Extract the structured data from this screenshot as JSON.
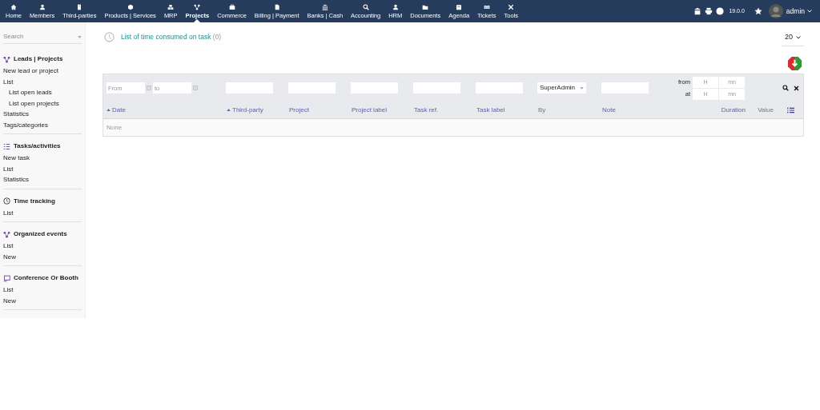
{
  "top_menu": [
    {
      "label": "Home",
      "selected": false
    },
    {
      "label": "Members",
      "selected": false
    },
    {
      "label": "Third-parties",
      "selected": false
    },
    {
      "label": "Products | Services",
      "selected": false
    },
    {
      "label": "MRP",
      "selected": false
    },
    {
      "label": "Projects",
      "selected": true
    },
    {
      "label": "Commerce",
      "selected": false
    },
    {
      "label": "Billing | Payment",
      "selected": false
    },
    {
      "label": "Banks | Cash",
      "selected": false
    },
    {
      "label": "Accounting",
      "selected": false
    },
    {
      "label": "HRM",
      "selected": false
    },
    {
      "label": "Documents",
      "selected": false
    },
    {
      "label": "Agenda",
      "selected": false
    },
    {
      "label": "Tickets",
      "selected": false
    },
    {
      "label": "Tools",
      "selected": false
    }
  ],
  "top_right": {
    "version": "19.0.0",
    "user": "admin"
  },
  "sidebar": {
    "search": {
      "placeholder": "Search"
    },
    "sections": [
      {
        "title": "Leads | Projects",
        "items": [
          {
            "label": "New lead or project"
          },
          {
            "label": "List",
            "children": [
              {
                "label": "List open leads"
              },
              {
                "label": "List open projects"
              }
            ]
          },
          {
            "label": "Statistics"
          },
          {
            "label": "Tags/categories"
          }
        ]
      },
      {
        "title": "Tasks/activities",
        "items": [
          {
            "label": "New task"
          },
          {
            "label": "List"
          },
          {
            "label": "Statistics"
          }
        ]
      },
      {
        "title": "Time tracking",
        "items": [
          {
            "label": "List"
          }
        ]
      },
      {
        "title": "Organized events",
        "items": [
          {
            "label": "List"
          },
          {
            "label": "New"
          }
        ]
      },
      {
        "title": "Conference Or Booth",
        "items": [
          {
            "label": "List"
          },
          {
            "label": "New"
          }
        ]
      }
    ]
  },
  "page": {
    "title": "List of time consumed on task",
    "count": "(0)",
    "page_size": "20"
  },
  "filters": {
    "date_from": {
      "placeholder": "From"
    },
    "date_to": {
      "placeholder": "to"
    },
    "by": "SuperAdmin",
    "duration": [
      {
        "label": "from",
        "hours_placeholder": "H",
        "minutes_placeholder": "mn"
      },
      {
        "label": "at",
        "hours_placeholder": "H",
        "minutes_placeholder": "mn"
      }
    ]
  },
  "table": {
    "columns": [
      {
        "label": "Date",
        "sort_arrow": true
      },
      {
        "label": "Third-party",
        "sort_arrow": true
      },
      {
        "label": "Project",
        "sort_arrow": false
      },
      {
        "label": "Project label",
        "sort_arrow": false
      },
      {
        "label": "Task ref.",
        "sort_arrow": false
      },
      {
        "label": "Task label",
        "sort_arrow": false
      },
      {
        "label": "By",
        "sort_arrow": false
      },
      {
        "label": "Note",
        "sort_arrow": false
      },
      {
        "label": "Duration",
        "sort_arrow": false
      },
      {
        "label": "Value",
        "sort_arrow": false
      }
    ],
    "empty_text": "None"
  }
}
